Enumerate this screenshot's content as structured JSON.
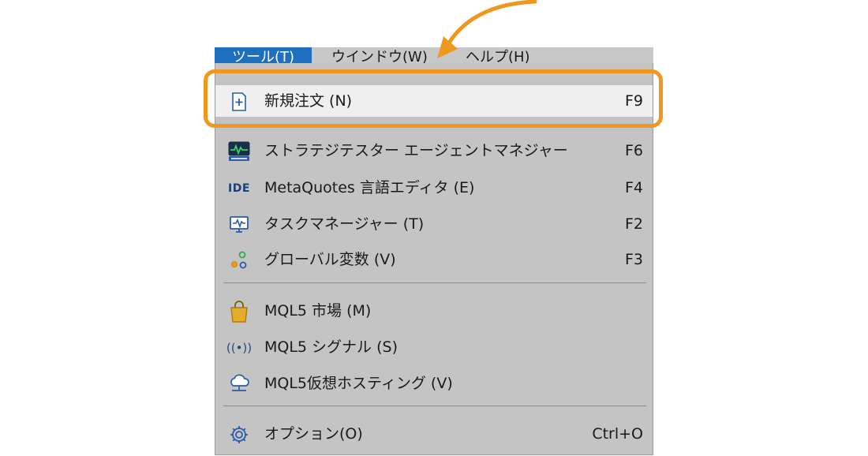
{
  "menubar": {
    "items": [
      {
        "label": "ツール(T)"
      },
      {
        "label": "ウインドウ(W)"
      },
      {
        "label": "ヘルプ(H)"
      }
    ]
  },
  "menu": {
    "items": [
      {
        "label": "新規注文 (N)",
        "shortcut": "F9",
        "icon": "new-order-icon"
      },
      {
        "label": "ストラテジテスター エージェントマネジャー",
        "shortcut": "F6",
        "icon": "strategy-tester-icon"
      },
      {
        "label": "MetaQuotes 言語エディタ (E)",
        "shortcut": "F4",
        "icon": "ide-icon",
        "icon_text": "IDE"
      },
      {
        "label": "タスクマネージャー (T)",
        "shortcut": "F2",
        "icon": "task-manager-icon"
      },
      {
        "label": "グローバル変数 (V)",
        "shortcut": "F3",
        "icon": "global-variables-icon"
      },
      {
        "label": "MQL5 市場 (M)",
        "icon": "market-bag-icon"
      },
      {
        "label": "MQL5 シグナル (S)",
        "icon": "signal-icon",
        "icon_text": "((•))"
      },
      {
        "label": "MQL5仮想ホスティング (V)",
        "icon": "cloud-hosting-icon"
      },
      {
        "label": "オプション(O)",
        "shortcut": "Ctrl+O",
        "icon": "gear-icon"
      }
    ]
  },
  "colors": {
    "highlight_border": "#f0971f",
    "menu_bg": "#c4c4c4",
    "active_menubar": "#1f6fc0"
  }
}
